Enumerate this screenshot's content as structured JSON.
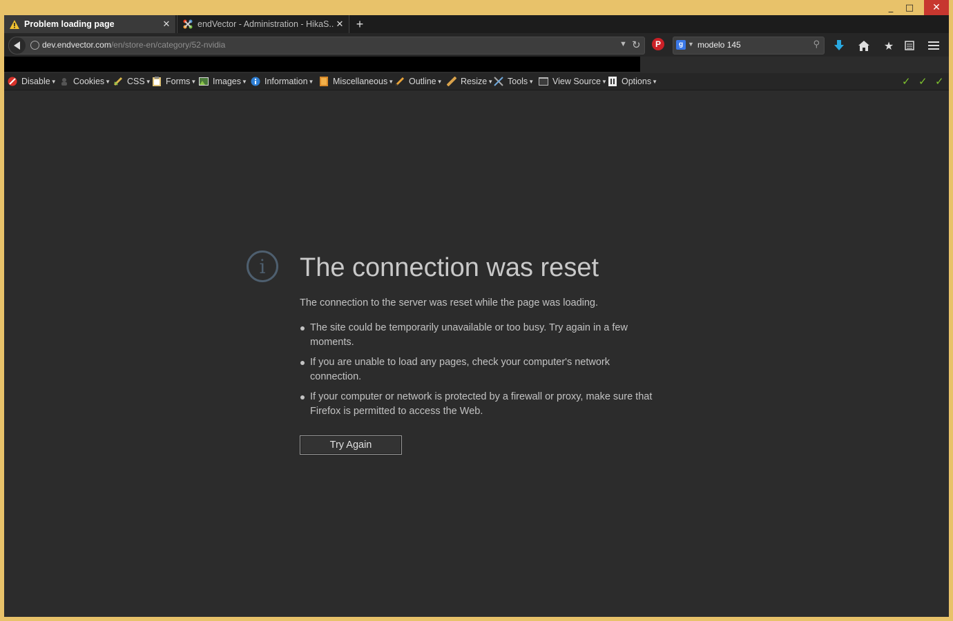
{
  "window": {
    "controls": {
      "minimize": "_",
      "maximize": "□",
      "close": "✕"
    }
  },
  "tabs": [
    {
      "label": "Problem loading page",
      "icon": "warning-icon",
      "active": true
    },
    {
      "label": "endVector - Administration - HikaS...",
      "icon": "joomla-icon",
      "active": false
    }
  ],
  "navbar": {
    "url_host": "dev.endvector.com",
    "url_path": "/en/store-en/category/52-nvidia",
    "search_value": "modelo 145"
  },
  "devtoolbar": {
    "items": [
      {
        "label": "Disable",
        "icon": "disable-icon"
      },
      {
        "label": "Cookies",
        "icon": "cookies-icon"
      },
      {
        "label": "CSS",
        "icon": "css-icon"
      },
      {
        "label": "Forms",
        "icon": "forms-icon"
      },
      {
        "label": "Images",
        "icon": "images-icon"
      },
      {
        "label": "Information",
        "icon": "information-icon"
      },
      {
        "label": "Miscellaneous",
        "icon": "miscellaneous-icon"
      },
      {
        "label": "Outline",
        "icon": "outline-icon"
      },
      {
        "label": "Resize",
        "icon": "resize-icon"
      },
      {
        "label": "Tools",
        "icon": "tools-icon"
      },
      {
        "label": "View Source",
        "icon": "view-source-icon"
      },
      {
        "label": "Options",
        "icon": "options-icon"
      }
    ],
    "status_colors": {
      "check": "#7ec22e"
    }
  },
  "error": {
    "title": "The connection was reset",
    "description": "The connection to the server was reset while the page was loading.",
    "bullets": [
      "The site could be temporarily unavailable or too busy. Try again in a few moments.",
      "If you are unable to load any pages, check your computer's network connection.",
      "If your computer or network is protected by a firewall or proxy, make sure that Firefox is permitted to access the Web."
    ],
    "button_label": "Try Again"
  }
}
